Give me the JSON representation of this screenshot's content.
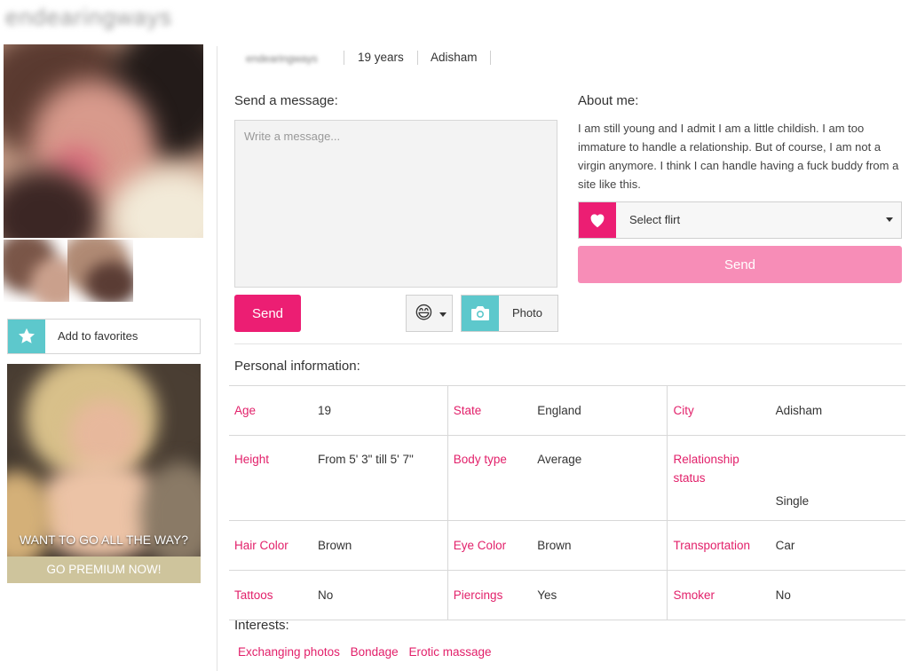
{
  "header": {
    "username_blurred": "endearingways"
  },
  "left": {
    "add_favorites_label": "Add to favorites",
    "promo_caption": "WANT TO GO ALL THE WAY?",
    "promo_cta": "GO PREMIUM NOW!"
  },
  "profile": {
    "username_blurred": "endearingways",
    "age_text": "19 years",
    "city": "Adisham"
  },
  "message": {
    "heading": "Send a message:",
    "placeholder": "Write a message...",
    "send_label": "Send",
    "photo_label": "Photo",
    "emoji_glyph": "😄"
  },
  "about": {
    "heading": "About me:",
    "text": "I am still young and I admit I am a little childish. I am too immature to handle a relationship. But of course, I am not a virgin anymore. I think I can handle having a fuck buddy from a site like this.",
    "flirt_select_label": "Select flirt",
    "send_label": "Send"
  },
  "personal": {
    "heading": "Personal information:",
    "age": {
      "label": "Age",
      "value": "19"
    },
    "state": {
      "label": "State",
      "value": "England"
    },
    "city": {
      "label": "City",
      "value": "Adisham"
    },
    "height": {
      "label": "Height",
      "value": "From 5' 3\" till 5' 7\""
    },
    "body_type": {
      "label": "Body type",
      "value": "Average"
    },
    "relationship": {
      "label": "Relationship status",
      "value": "Single"
    },
    "hair": {
      "label": "Hair Color",
      "value": "Brown"
    },
    "eye": {
      "label": "Eye Color",
      "value": "Brown"
    },
    "transport": {
      "label": "Transportation",
      "value": "Car"
    },
    "tattoos": {
      "label": "Tattoos",
      "value": "No"
    },
    "piercings": {
      "label": "Piercings",
      "value": "Yes"
    },
    "smoker": {
      "label": "Smoker",
      "value": "No"
    }
  },
  "interests": {
    "heading": "Interests:",
    "items": [
      "Exchanging photos",
      "Bondage",
      "Erotic massage"
    ]
  },
  "colors": {
    "accent_pink": "#ec1e73",
    "label_pink": "#e2206a",
    "light_pink": "#f78db7",
    "teal": "#5dc8cc",
    "promo_gold": "#cec49c"
  }
}
